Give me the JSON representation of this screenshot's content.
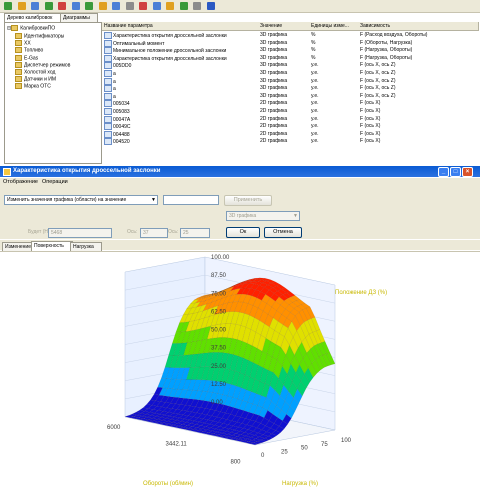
{
  "toolbar": {
    "icons": [
      "folder-open-icon",
      "save-icon",
      "arrow-left-icon",
      "arrow-right-icon",
      "upload-icon",
      "download-icon",
      "refresh-icon",
      "copy-icon",
      "paste-icon",
      "table-icon",
      "chart-icon",
      "print-icon",
      "zoom-icon",
      "settings-icon",
      "link-icon",
      "help-icon"
    ]
  },
  "top_tabs": [
    "Дерево калибровок",
    "Диаграммы"
  ],
  "tree": {
    "root": "КалибровкиПО",
    "items": [
      "Идентификаторы",
      "ХХ",
      "Топливо",
      "E-Gas",
      "Диспетчер режимов",
      "Холостой ход",
      "Датчики и ИМ",
      "Марка ОТС"
    ]
  },
  "table": {
    "columns": [
      "Название параметра",
      "Значение",
      "Единицы изме...",
      "Зависимость"
    ],
    "rows": [
      [
        "Характеристика открытия дроссельной заслонки",
        "3D графика",
        "%",
        "F (Расход воздуха, Обороты)"
      ],
      [
        "Оптимальный момент",
        "3D графика",
        "%",
        "F (Обороты, Нагрузка)"
      ],
      [
        "Минимальное положение дроссельной заслонки",
        "3D графика",
        "%",
        "F (Нагрузка, Обороты)"
      ],
      [
        "Характеристика открытия дроссельной заслонки",
        "3D графика",
        "%",
        "F (Нагрузка, Обороты)"
      ],
      [
        "005DD0",
        "3D графика",
        "у.е.",
        "F (ось X, ось Z)"
      ],
      [
        "а",
        "3D графика",
        "у.е.",
        "F (ось X, ось Z)"
      ],
      [
        "а",
        "3D графика",
        "у.е.",
        "F (ось X, ось Z)"
      ],
      [
        "а",
        "3D графика",
        "у.е.",
        "F (ось X, ось Z)"
      ],
      [
        "а",
        "3D графика",
        "у.е.",
        "F (ось X, ось Z)"
      ],
      [
        "005034",
        "2D графика",
        "у.е.",
        "F (ось X)"
      ],
      [
        "005083",
        "2D графика",
        "у.е.",
        "F (ось X)"
      ],
      [
        "00047A",
        "2D графика",
        "у.е.",
        "F (ось X)"
      ],
      [
        "00049C",
        "2D графика",
        "у.е.",
        "F (ось X)"
      ],
      [
        "004488",
        "2D графика",
        "у.е.",
        "F (ось X)"
      ],
      [
        "004520",
        "2D графика",
        "у.е.",
        "F (ось X)"
      ]
    ]
  },
  "dialog": {
    "title": "Характеристика открытия дроссельной заслонки",
    "menu": [
      "Отображение",
      "Операции"
    ],
    "mode_select": "Изменить значения графика (области) на значение",
    "value_input": "",
    "apply_label": "Применить",
    "graph_select": "3D графика",
    "fields": [
      {
        "label": "Будет (Нм):",
        "value": "5468"
      },
      {
        "label": "Ось:",
        "value": "37"
      },
      {
        "label": "Ось:",
        "value": "25"
      }
    ],
    "ok_label": "Ок",
    "cancel_label": "Отмена",
    "tabs": [
      "Изменение",
      "Поверхность",
      "Нагрузка"
    ],
    "active_tab": "Поверхность"
  },
  "chart_data": {
    "type": "surface3d",
    "title": "Положение ДЗ (%)",
    "xlabel": "Обороты (об/мин)",
    "ylabel": "Нагрузка (%)",
    "zlabel": "Положение ДЗ (%)",
    "z_ticks": [
      "100.00",
      "87.50",
      "75.00",
      "62.50",
      "50.00",
      "37.50",
      "25.00",
      "12.50",
      "0.00"
    ],
    "x_ticks": [
      "6000",
      "3442.11",
      "800"
    ],
    "y_ticks": [
      "0",
      "25",
      "50",
      "75",
      "100"
    ],
    "zlim": [
      0,
      100
    ],
    "colors": [
      "#1010d0",
      "#00a0ff",
      "#00d070",
      "#60e000",
      "#e0e000",
      "#ff9000",
      "#ff2000"
    ]
  },
  "colors": {
    "title_bar": "#0a5bd3",
    "axis_label": "#e5d800",
    "panel": "#ece9d8"
  }
}
